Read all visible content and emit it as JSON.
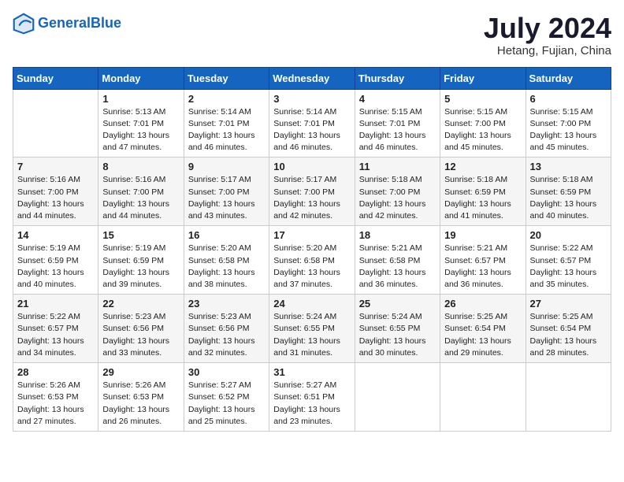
{
  "header": {
    "logo_line1": "General",
    "logo_line2": "Blue",
    "month_year": "July 2024",
    "location": "Hetang, Fujian, China"
  },
  "columns": [
    "Sunday",
    "Monday",
    "Tuesday",
    "Wednesday",
    "Thursday",
    "Friday",
    "Saturday"
  ],
  "weeks": [
    [
      {
        "day": "",
        "sunrise": "",
        "sunset": "",
        "daylight": ""
      },
      {
        "day": "1",
        "sunrise": "Sunrise: 5:13 AM",
        "sunset": "Sunset: 7:01 PM",
        "daylight": "Daylight: 13 hours and 47 minutes."
      },
      {
        "day": "2",
        "sunrise": "Sunrise: 5:14 AM",
        "sunset": "Sunset: 7:01 PM",
        "daylight": "Daylight: 13 hours and 46 minutes."
      },
      {
        "day": "3",
        "sunrise": "Sunrise: 5:14 AM",
        "sunset": "Sunset: 7:01 PM",
        "daylight": "Daylight: 13 hours and 46 minutes."
      },
      {
        "day": "4",
        "sunrise": "Sunrise: 5:15 AM",
        "sunset": "Sunset: 7:01 PM",
        "daylight": "Daylight: 13 hours and 46 minutes."
      },
      {
        "day": "5",
        "sunrise": "Sunrise: 5:15 AM",
        "sunset": "Sunset: 7:00 PM",
        "daylight": "Daylight: 13 hours and 45 minutes."
      },
      {
        "day": "6",
        "sunrise": "Sunrise: 5:15 AM",
        "sunset": "Sunset: 7:00 PM",
        "daylight": "Daylight: 13 hours and 45 minutes."
      }
    ],
    [
      {
        "day": "7",
        "sunrise": "Sunrise: 5:16 AM",
        "sunset": "Sunset: 7:00 PM",
        "daylight": "Daylight: 13 hours and 44 minutes."
      },
      {
        "day": "8",
        "sunrise": "Sunrise: 5:16 AM",
        "sunset": "Sunset: 7:00 PM",
        "daylight": "Daylight: 13 hours and 44 minutes."
      },
      {
        "day": "9",
        "sunrise": "Sunrise: 5:17 AM",
        "sunset": "Sunset: 7:00 PM",
        "daylight": "Daylight: 13 hours and 43 minutes."
      },
      {
        "day": "10",
        "sunrise": "Sunrise: 5:17 AM",
        "sunset": "Sunset: 7:00 PM",
        "daylight": "Daylight: 13 hours and 42 minutes."
      },
      {
        "day": "11",
        "sunrise": "Sunrise: 5:18 AM",
        "sunset": "Sunset: 7:00 PM",
        "daylight": "Daylight: 13 hours and 42 minutes."
      },
      {
        "day": "12",
        "sunrise": "Sunrise: 5:18 AM",
        "sunset": "Sunset: 6:59 PM",
        "daylight": "Daylight: 13 hours and 41 minutes."
      },
      {
        "day": "13",
        "sunrise": "Sunrise: 5:18 AM",
        "sunset": "Sunset: 6:59 PM",
        "daylight": "Daylight: 13 hours and 40 minutes."
      }
    ],
    [
      {
        "day": "14",
        "sunrise": "Sunrise: 5:19 AM",
        "sunset": "Sunset: 6:59 PM",
        "daylight": "Daylight: 13 hours and 40 minutes."
      },
      {
        "day": "15",
        "sunrise": "Sunrise: 5:19 AM",
        "sunset": "Sunset: 6:59 PM",
        "daylight": "Daylight: 13 hours and 39 minutes."
      },
      {
        "day": "16",
        "sunrise": "Sunrise: 5:20 AM",
        "sunset": "Sunset: 6:58 PM",
        "daylight": "Daylight: 13 hours and 38 minutes."
      },
      {
        "day": "17",
        "sunrise": "Sunrise: 5:20 AM",
        "sunset": "Sunset: 6:58 PM",
        "daylight": "Daylight: 13 hours and 37 minutes."
      },
      {
        "day": "18",
        "sunrise": "Sunrise: 5:21 AM",
        "sunset": "Sunset: 6:58 PM",
        "daylight": "Daylight: 13 hours and 36 minutes."
      },
      {
        "day": "19",
        "sunrise": "Sunrise: 5:21 AM",
        "sunset": "Sunset: 6:57 PM",
        "daylight": "Daylight: 13 hours and 36 minutes."
      },
      {
        "day": "20",
        "sunrise": "Sunrise: 5:22 AM",
        "sunset": "Sunset: 6:57 PM",
        "daylight": "Daylight: 13 hours and 35 minutes."
      }
    ],
    [
      {
        "day": "21",
        "sunrise": "Sunrise: 5:22 AM",
        "sunset": "Sunset: 6:57 PM",
        "daylight": "Daylight: 13 hours and 34 minutes."
      },
      {
        "day": "22",
        "sunrise": "Sunrise: 5:23 AM",
        "sunset": "Sunset: 6:56 PM",
        "daylight": "Daylight: 13 hours and 33 minutes."
      },
      {
        "day": "23",
        "sunrise": "Sunrise: 5:23 AM",
        "sunset": "Sunset: 6:56 PM",
        "daylight": "Daylight: 13 hours and 32 minutes."
      },
      {
        "day": "24",
        "sunrise": "Sunrise: 5:24 AM",
        "sunset": "Sunset: 6:55 PM",
        "daylight": "Daylight: 13 hours and 31 minutes."
      },
      {
        "day": "25",
        "sunrise": "Sunrise: 5:24 AM",
        "sunset": "Sunset: 6:55 PM",
        "daylight": "Daylight: 13 hours and 30 minutes."
      },
      {
        "day": "26",
        "sunrise": "Sunrise: 5:25 AM",
        "sunset": "Sunset: 6:54 PM",
        "daylight": "Daylight: 13 hours and 29 minutes."
      },
      {
        "day": "27",
        "sunrise": "Sunrise: 5:25 AM",
        "sunset": "Sunset: 6:54 PM",
        "daylight": "Daylight: 13 hours and 28 minutes."
      }
    ],
    [
      {
        "day": "28",
        "sunrise": "Sunrise: 5:26 AM",
        "sunset": "Sunset: 6:53 PM",
        "daylight": "Daylight: 13 hours and 27 minutes."
      },
      {
        "day": "29",
        "sunrise": "Sunrise: 5:26 AM",
        "sunset": "Sunset: 6:53 PM",
        "daylight": "Daylight: 13 hours and 26 minutes."
      },
      {
        "day": "30",
        "sunrise": "Sunrise: 5:27 AM",
        "sunset": "Sunset: 6:52 PM",
        "daylight": "Daylight: 13 hours and 25 minutes."
      },
      {
        "day": "31",
        "sunrise": "Sunrise: 5:27 AM",
        "sunset": "Sunset: 6:51 PM",
        "daylight": "Daylight: 13 hours and 23 minutes."
      },
      {
        "day": "",
        "sunrise": "",
        "sunset": "",
        "daylight": ""
      },
      {
        "day": "",
        "sunrise": "",
        "sunset": "",
        "daylight": ""
      },
      {
        "day": "",
        "sunrise": "",
        "sunset": "",
        "daylight": ""
      }
    ]
  ]
}
